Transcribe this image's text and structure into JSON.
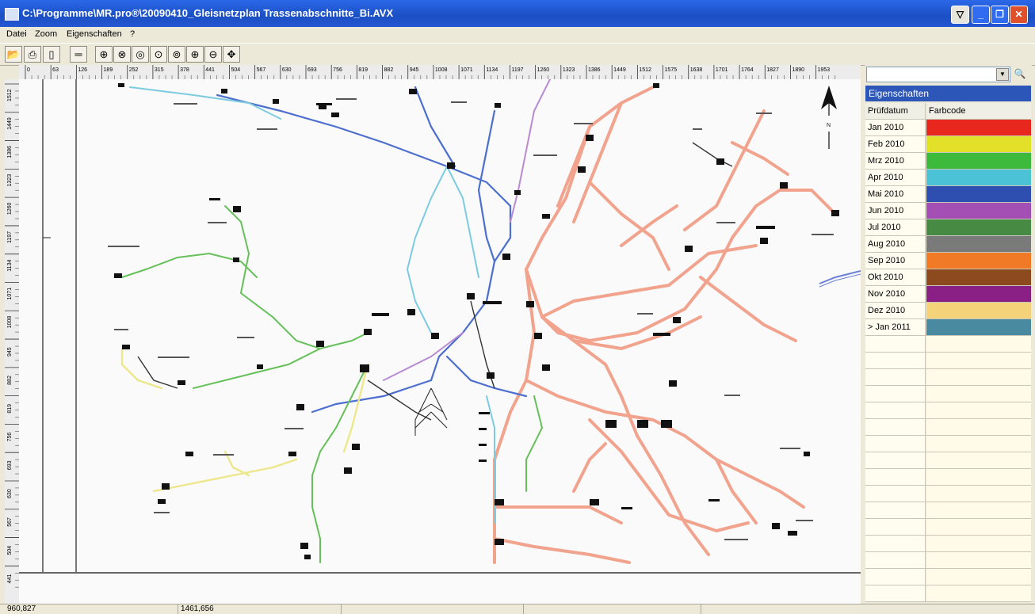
{
  "window": {
    "title": "C:\\Programme\\MR.pro®\\20090410_Gleisnetzplan Trassenabschnitte_Bi.AVX"
  },
  "menu": {
    "items": [
      "Datei",
      "Zoom",
      "Eigenschaften",
      "?"
    ]
  },
  "toolbar": {
    "buttons": [
      "open-icon",
      "print-icon",
      "print-preview-icon",
      "measure-icon",
      "zoom-icon",
      "zoom-window-icon",
      "zoom-out-icon",
      "zoom-extent-icon",
      "zoom-previous-icon",
      "zoom-in-icon",
      "zoom-out-small-icon",
      "pan-icon"
    ]
  },
  "ruler": {
    "top_ticks": [
      "0",
      "63",
      "126",
      "189",
      "252",
      "315",
      "378",
      "441",
      "504",
      "567",
      "630",
      "693",
      "756",
      "819",
      "882",
      "945",
      "1008",
      "1071",
      "1134",
      "1197",
      "1260",
      "1323",
      "1386",
      "1449",
      "1512",
      "1575",
      "1638",
      "1701",
      "1764",
      "1827",
      "1890",
      "1953"
    ],
    "left_ticks": [
      "1512",
      "1449",
      "1386",
      "1323",
      "1260",
      "1197",
      "1134",
      "1071",
      "1008",
      "945",
      "882",
      "819",
      "756",
      "693",
      "630",
      "567",
      "504",
      "441"
    ]
  },
  "map": {
    "north_label": "N"
  },
  "status": {
    "x_coord": "960,827",
    "y_coord": "1461,656"
  },
  "properties": {
    "header": "Eigenschaften",
    "col_date": "Prüfdatum",
    "col_color": "Farbcode",
    "rows": [
      {
        "label": "Jan 2010",
        "color": "#e8281e"
      },
      {
        "label": "Feb 2010",
        "color": "#e3e02a"
      },
      {
        "label": "Mrz 2010",
        "color": "#3dba3b"
      },
      {
        "label": "Apr 2010",
        "color": "#4cc2d6"
      },
      {
        "label": "Mai 2010",
        "color": "#2f4fb0"
      },
      {
        "label": "Jun 2010",
        "color": "#a34fb3"
      },
      {
        "label": "Jul 2010",
        "color": "#468a44"
      },
      {
        "label": "Aug 2010",
        "color": "#7a7a7a"
      },
      {
        "label": "Sep 2010",
        "color": "#f07a25"
      },
      {
        "label": "Okt 2010",
        "color": "#8d4a1e"
      },
      {
        "label": "Nov 2010",
        "color": "#8a1f86"
      },
      {
        "label": "Dez 2010",
        "color": "#f4d27a"
      },
      {
        "label": "> Jan 2011",
        "color": "#4a8aa0"
      }
    ]
  },
  "colors": {
    "title_bar": "#1b4fc4",
    "panel_header": "#2c56b8",
    "line_salmon": "#f2a38d",
    "line_blue": "#4c6fcf",
    "line_cyan": "#7ccbe0",
    "line_green": "#66c05a",
    "line_yellow": "#ece78a",
    "line_purple": "#b98bd0"
  }
}
